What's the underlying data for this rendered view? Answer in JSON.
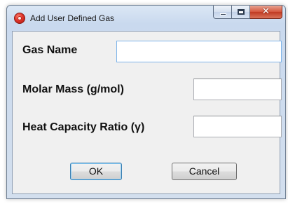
{
  "window": {
    "title": "Add User Defined Gas",
    "icon": "app-icon"
  },
  "caption_buttons": {
    "minimize": "minimize-icon",
    "maximize": "maximize-icon",
    "close_glyph": "✕"
  },
  "form": {
    "gas_name_label": "Gas Name",
    "gas_name_value": "",
    "molar_mass_label": "Molar Mass (g/mol)",
    "molar_mass_value": "",
    "heat_capacity_label": "Heat Capacity Ratio (γ)",
    "heat_capacity_value": ""
  },
  "buttons": {
    "ok_label": "OK",
    "cancel_label": "Cancel"
  },
  "colors": {
    "focus_border": "#7eb4ea",
    "close_button": "#c03a22"
  }
}
